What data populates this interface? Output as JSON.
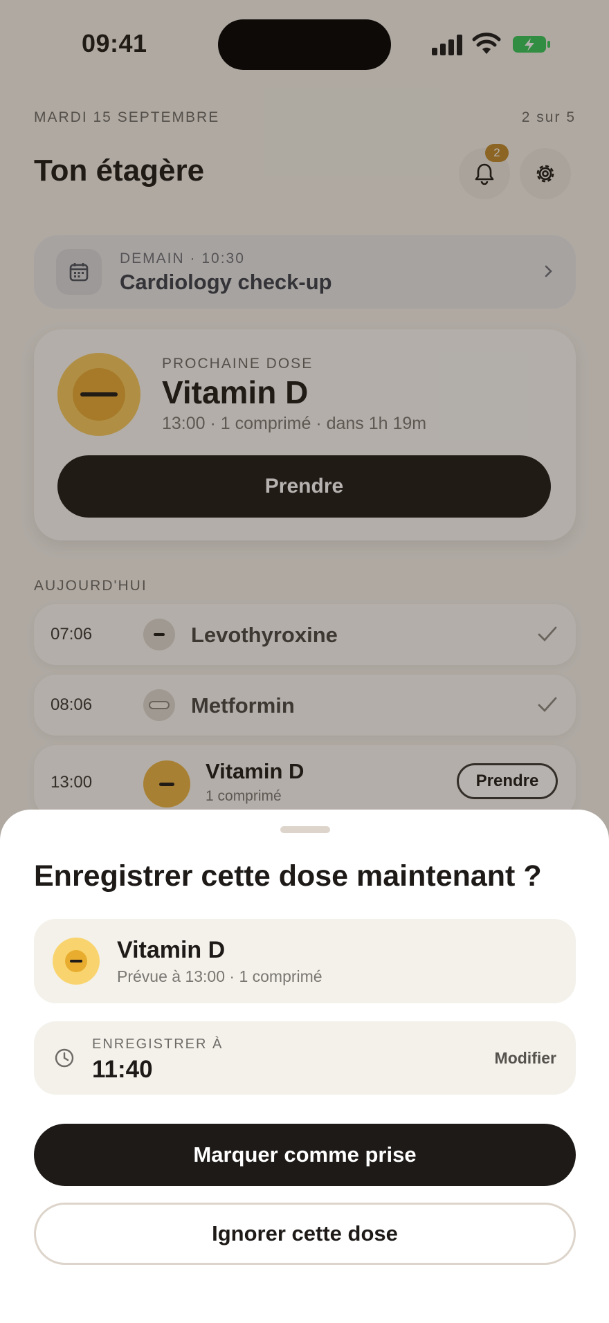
{
  "status_bar": {
    "time": "09:41"
  },
  "header": {
    "date": "MARDI 15 SEPTEMBRE",
    "page_count": "2 sur 5",
    "title": "Ton étagère",
    "notification_count": "2"
  },
  "appointment": {
    "meta": "DEMAIN · 10:30",
    "title": "Cardiology check-up"
  },
  "next_dose": {
    "label": "PROCHAINE DOSE",
    "name": "Vitamin D",
    "detail": "13:00 · 1 comprimé · dans 1h 19m",
    "take_label": "Prendre"
  },
  "today": {
    "label": "AUJOURD'HUI",
    "items": [
      {
        "time": "07:06",
        "name": "Levothyroxine",
        "status": "taken"
      },
      {
        "time": "08:06",
        "name": "Metformin",
        "status": "taken"
      },
      {
        "time": "13:00",
        "name": "Vitamin D",
        "sub": "1 comprimé",
        "take_label": "Prendre"
      }
    ]
  },
  "sheet": {
    "title": "Enregistrer cette dose maintenant ?",
    "med_name": "Vitamin D",
    "med_schedule": "Prévue à 13:00 · 1 comprimé",
    "record_label": "ENREGISTRER À",
    "record_time": "11:40",
    "modify_label": "Modifier",
    "mark_label": "Marquer comme prise",
    "ignore_label": "Ignorer cette dose"
  },
  "colors": {
    "accent_yellow": "#f6ca5e",
    "dark_button": "#1e1a18",
    "badge": "#c08a2c"
  }
}
